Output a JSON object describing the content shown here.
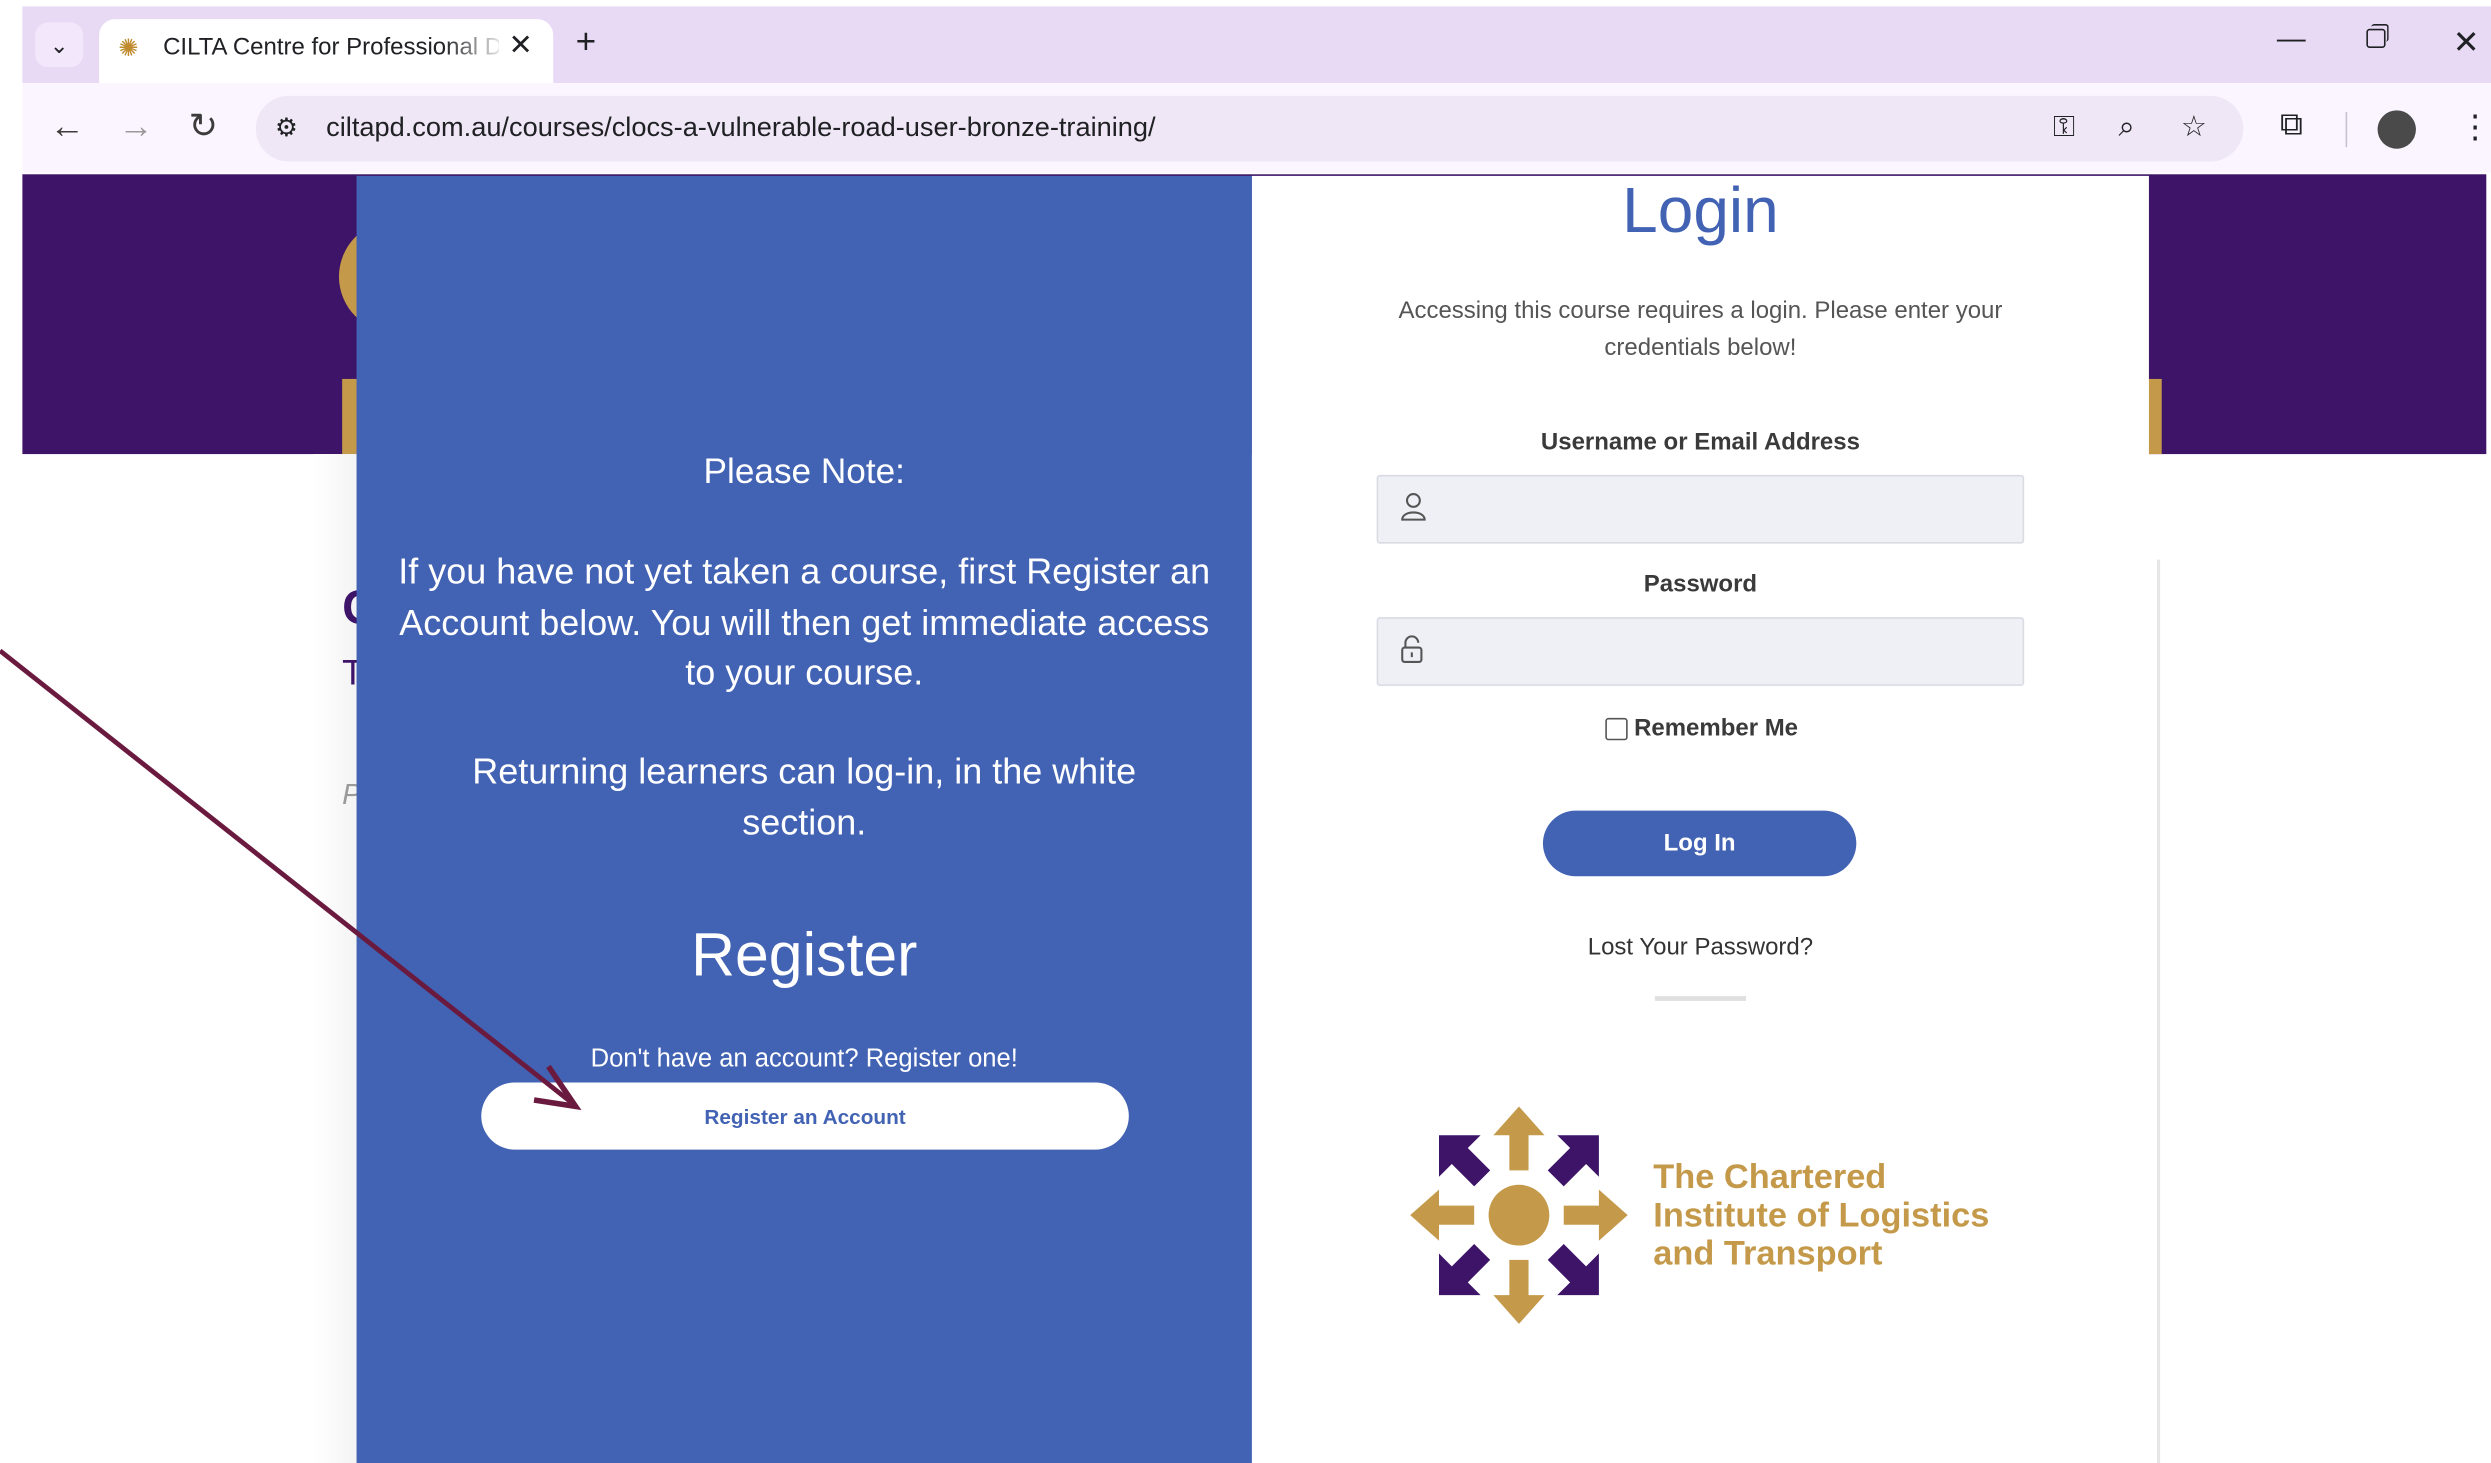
{
  "browser": {
    "tab_title": "CILTA Centre for Professional Development",
    "url": "ciltapd.com.au/courses/clocs-a-vulnerable-road-user-bronze-training/",
    "icons": {
      "tab_list": "chevron-down-icon",
      "favicon": "cilta-favicon-icon",
      "tab_close": "close-icon",
      "new_tab": "plus-icon",
      "back": "arrow-left-icon",
      "forward": "arrow-right-icon",
      "reload": "reload-icon",
      "site_info": "site-settings-icon",
      "passwords": "key-icon",
      "zoom": "zoom-icon",
      "bookmark": "star-icon",
      "extensions": "puzzle-icon",
      "menu": "kebab-menu-icon"
    }
  },
  "page": {
    "fragment_c": "C",
    "fragment_t": "T",
    "fragment_p": "P"
  },
  "modal": {
    "left": {
      "note_title": "Please Note:",
      "note_body": "If you have not yet taken a course, first Register an Account below. You will then get immediate access to your course.",
      "note_body2": "Returning learners can log-in, in the white section.",
      "register_title": "Register",
      "register_sub": "Don't have an account? Register one!",
      "register_button": "Register an Account"
    },
    "right": {
      "title": "Login",
      "description": "Accessing this course requires a login. Please enter your credentials below!",
      "username_label": "Username or Email Address",
      "username_value": "",
      "password_label": "Password",
      "password_value": "",
      "remember_label": "Remember Me",
      "remember_checked": false,
      "login_button": "Log In",
      "lost_password": "Lost Your Password?",
      "logo_line1": "The Chartered",
      "logo_line2": "Institute of Logistics",
      "logo_line3": "and Transport"
    }
  },
  "colors": {
    "brand_purple": "#3d1468",
    "modal_blue": "#4262b3",
    "gold": "#c49a4a",
    "annotation_arrow": "#6b1a3f"
  }
}
